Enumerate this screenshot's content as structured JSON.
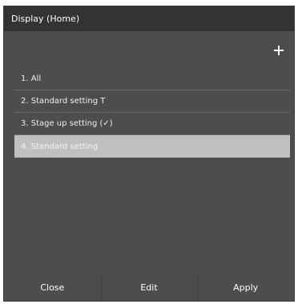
{
  "window": {
    "title": "Display (Home)"
  },
  "toolbar": {
    "add_icon": "plus-icon"
  },
  "list": {
    "items": [
      {
        "label": "1. All",
        "selected": false
      },
      {
        "label": "2. Standard setting T",
        "selected": false
      },
      {
        "label": "3. Stage up setting (✓)",
        "selected": false
      },
      {
        "label": "4. Standard setting",
        "selected": true
      }
    ]
  },
  "footer": {
    "close_label": "Close",
    "edit_label": "Edit",
    "apply_label": "Apply"
  },
  "colors": {
    "panel_bg": "#4d4d4d",
    "titlebar_bg": "#333333",
    "selected_bg": "#c0c0c0"
  }
}
